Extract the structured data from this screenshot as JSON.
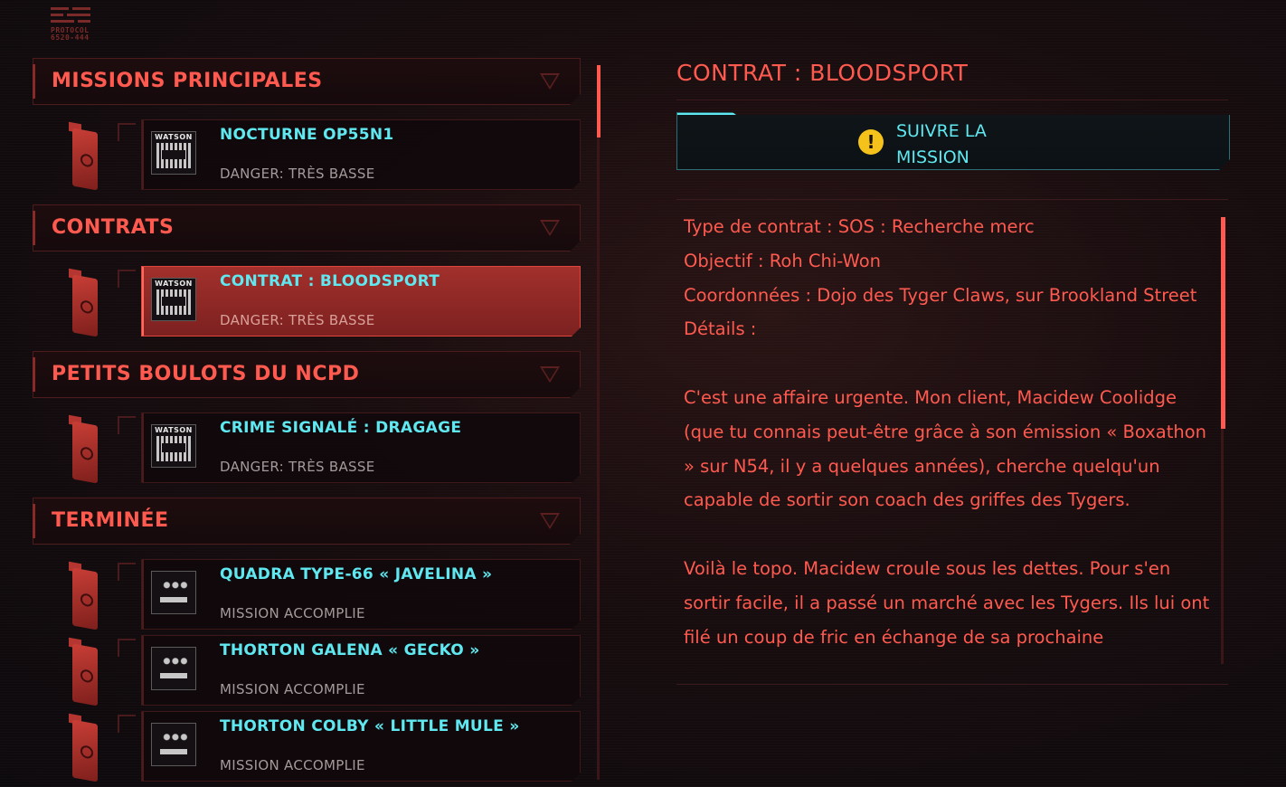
{
  "header": {
    "logo_line1": "PROTOCOL",
    "logo_line2": "6520-444"
  },
  "sections": [
    {
      "title": "MISSIONS PRINCIPALES",
      "expanded": true,
      "items": [
        {
          "title": "NOCTURNE OP55N1",
          "subtitle": "DANGER: TRÈS BASSE",
          "badge": "WATSON",
          "badge_icon": "watson-district-icon",
          "active": false
        }
      ]
    },
    {
      "title": "CONTRATS",
      "expanded": true,
      "items": [
        {
          "title": "CONTRAT : BLOODSPORT",
          "subtitle": "DANGER: TRÈS BASSE",
          "badge": "WATSON",
          "badge_icon": "watson-district-icon",
          "active": true
        }
      ]
    },
    {
      "title": "PETITS BOULOTS DU NCPD",
      "expanded": true,
      "items": [
        {
          "title": "CRIME SIGNALÉ : DRAGAGE",
          "subtitle": "DANGER: TRÈS BASSE",
          "badge": "WATSON",
          "badge_icon": "watson-district-icon",
          "active": false
        }
      ]
    },
    {
      "title": "TERMINÉE",
      "expanded": true,
      "items": [
        {
          "title": "QUADRA TYPE-66 « JAVELINA »",
          "subtitle": "MISSION ACCOMPLIE",
          "badge_icon": "badlands-district-icon",
          "active": false
        },
        {
          "title": "THORTON GALENA « GECKO »",
          "subtitle": "MISSION ACCOMPLIE",
          "badge_icon": "badlands-district-icon",
          "active": false
        },
        {
          "title": "THORTON COLBY « LITTLE MULE »",
          "subtitle": "MISSION ACCOMPLIE",
          "badge_icon": "badlands-district-icon",
          "active": false
        }
      ]
    }
  ],
  "detail": {
    "title": "CONTRAT : BLOODSPORT",
    "track_button": "SUIVRE LA MISSION",
    "lines": [
      "Type de contrat : SOS : Recherche merc",
      "Objectif : Roh Chi-Won",
      "Coordonnées : Dojo des Tyger Claws, sur Brookland Street",
      "Détails :"
    ],
    "paragraphs": [
      "C'est une affaire urgente. Mon client, Macidew Coolidge (que tu connais peut-être grâce à son émission « Boxathon » sur N54, il y a quelques années), cherche quelqu'un capable de sortir son coach des griffes des Tygers.",
      "Voilà le topo. Macidew croule sous les dettes. Pour s'en sortir facile, il a passé un marché avec les Tygers. Ils lui ont filé un coup de fric en échange de sa prochaine"
    ]
  },
  "colors": {
    "accent_red": "#ff5a4f",
    "accent_cyan": "#5fe8f0",
    "warning_yellow": "#f5c21b",
    "active_card": "#a2302c"
  }
}
